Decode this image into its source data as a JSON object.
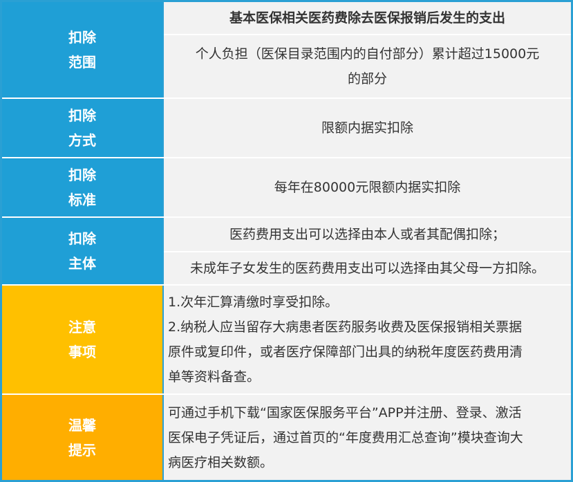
{
  "rows": [
    {
      "label_1": "扣除",
      "label_2": "范围",
      "header": "基本医保相关医药费除去医保报销后发生的支出",
      "content_1": "个人负担（医保目录范围内的自付部分）累计超过15000元",
      "content_2": "的部分"
    },
    {
      "label_1": "扣除",
      "label_2": "方式",
      "content": "限额内据实扣除"
    },
    {
      "label_1": "扣除",
      "label_2": "标准",
      "content": "每年在80000元限额内据实扣除"
    },
    {
      "label_1": "扣除",
      "label_2": "主体",
      "content_1": "医药费用支出可以选择由本人或者其配偶扣除；",
      "content_2": "未成年子女发生的医药费用支出可以选择由其父母一方扣除。"
    },
    {
      "label_1": "注意",
      "label_2": "事项",
      "line_1": "1.次年汇算清缴时享受扣除。",
      "line_2": "2.纳税人应当留存大病患者医药服务收费及医保报销相关票据",
      "line_3": "原件或复印件，或者医疗保障部门出具的纳税年度医药费用清",
      "line_4": "单等资料备查。"
    },
    {
      "label_1": "温馨",
      "label_2": "提示",
      "line_1": "可通过手机下载“国家医保服务平台”APP并注册、登录、激活",
      "line_2": "医保电子凭证后，通过首页的“年度费用汇总查询”模块查询大",
      "line_3": "病医疗相关数额。"
    }
  ],
  "colors": {
    "blue": "#1f9fd6",
    "yellow": "#ffc000",
    "orange": "#ffae00",
    "cell_bg": "#f2f2f2",
    "text": "#333333"
  }
}
